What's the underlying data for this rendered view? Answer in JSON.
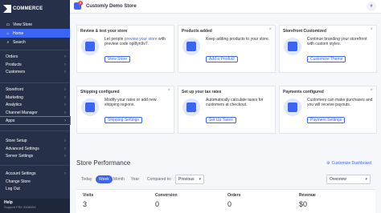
{
  "brand": {
    "name": "COMMERCE"
  },
  "sidebar": {
    "top_items": [
      {
        "label": "View Store",
        "icon": "storefront-icon"
      },
      {
        "label": "Home",
        "icon": "home-icon"
      },
      {
        "label": "Search",
        "icon": "search-icon"
      }
    ],
    "group1": [
      "Orders",
      "Products",
      "Customers"
    ],
    "group2": [
      "Storefront",
      "Marketing",
      "Analytics",
      "Channel Manager",
      "Apps"
    ],
    "group3": [
      "Store Setup",
      "Advanced Settings",
      "Server Settings"
    ],
    "group4": [
      "Account Settings",
      "Change Store",
      "Log Out"
    ],
    "help": {
      "title": "Help",
      "subtitle": "Support PIN: 9468454"
    }
  },
  "topbar": {
    "store_name": "Customly Demo Store",
    "badge_count": "5"
  },
  "cards": [
    {
      "title": "Review & test your store",
      "body_pre": "Let people ",
      "link": "preview your store",
      "body_post": " with preview code opl8yn9v7.",
      "button": "View Store",
      "icon": "rocket-icon"
    },
    {
      "title": "Products added",
      "body_pre": "Keep adding products to your store.",
      "link": "",
      "body_post": "",
      "button": "Add a Product",
      "icon": "product-box-icon"
    },
    {
      "title": "Storefront Customized",
      "body_pre": "Continue branding your storefront with custom styles.",
      "link": "",
      "body_post": "",
      "button": "Customize Theme",
      "icon": "monitor-icon"
    },
    {
      "title": "Shipping configured",
      "body_pre": "Modify your rates or add new shipping regions.",
      "link": "",
      "body_post": "",
      "button": "Shipping Settings",
      "icon": "truck-icon"
    },
    {
      "title": "Set up your tax rates",
      "body_pre": "Automatically calculate taxes for customers at checkout.",
      "link": "",
      "body_post": "",
      "button": "Set Up Taxes",
      "icon": "calculator-icon"
    },
    {
      "title": "Payments configured",
      "body_pre": "Customers can make purchases and you will receive payouts.",
      "link": "",
      "body_post": "",
      "button": "Payment Settings",
      "icon": "credit-card-icon"
    }
  ],
  "performance": {
    "title": "Store Performance",
    "customize_link": "Customize Dashboard",
    "periods": [
      "Today",
      "Week",
      "Month",
      "Year"
    ],
    "selected_period": "Week",
    "compared_label": "Compared to:",
    "compared_value": "Previous",
    "view_value": "Overview",
    "stats": [
      {
        "label": "Visits",
        "value": "3"
      },
      {
        "label": "Conversion",
        "value": "0"
      },
      {
        "label": "Orders",
        "value": "0"
      },
      {
        "label": "Revenue",
        "value": "$0"
      }
    ]
  },
  "colors": {
    "sidebar": "#263048",
    "accent": "#3c64f4",
    "highlight": "#e53f7a"
  }
}
